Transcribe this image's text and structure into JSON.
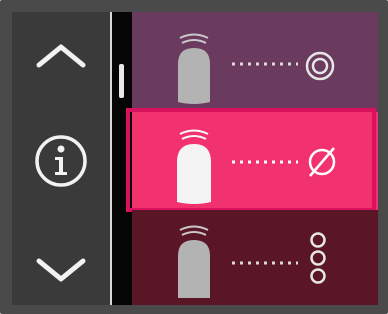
{
  "navigation": {
    "up_icon": "chevron-up-icon",
    "info_icon": "info-icon",
    "down_icon": "chevron-down-icon"
  },
  "options": [
    {
      "icon": "tooth-icon",
      "status_icon": "double-circle-icon",
      "selected": false,
      "color": "#6b3a5f"
    },
    {
      "icon": "tooth-icon",
      "status_icon": "empty-set-icon",
      "selected": true,
      "color": "#f2326f"
    },
    {
      "icon": "tooth-icon",
      "status_icon": "three-circles-icon",
      "selected": false,
      "color": "#5a1526"
    }
  ],
  "colors": {
    "frame": "#4a4a4a",
    "nav_panel": "#3a3a3a",
    "selected_border": "#d9125f",
    "icon": "#e6e6e6"
  }
}
